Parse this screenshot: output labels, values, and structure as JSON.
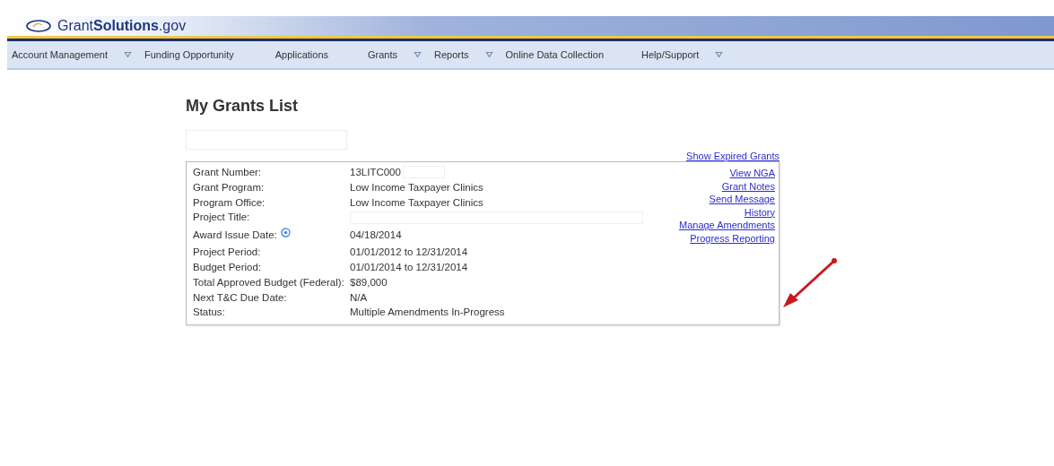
{
  "logo": {
    "text": "Grant**Solutions**.gov"
  },
  "nav": [
    {
      "label": "Account Management",
      "has_menu": true
    },
    {
      "label": "Funding Opportunity",
      "has_menu": false
    },
    {
      "label": "Applications",
      "has_menu": false
    },
    {
      "label": "Grants",
      "has_menu": true
    },
    {
      "label": "Reports",
      "has_menu": true
    },
    {
      "label": "Online Data Collection",
      "has_menu": false
    },
    {
      "label": "Help/Support",
      "has_menu": true
    }
  ],
  "page_title": "My Grants List",
  "show_expired_link": "Show Expired Grants",
  "grant": {
    "fields": [
      {
        "label": "Grant Number:",
        "value": "13LITC000",
        "redacted": true,
        "help": false
      },
      {
        "label": "Grant Program:",
        "value": "Low Income Taxpayer Clinics",
        "redacted": false,
        "help": false
      },
      {
        "label": "Program Office:",
        "value": "Low Income Taxpayer Clinics",
        "redacted": false,
        "help": false
      },
      {
        "label": "Project Title:",
        "redacted": true,
        "help": false
      },
      {
        "label": "Award Issue Date:",
        "value": "04/18/2014",
        "redacted": false,
        "help": true
      },
      {
        "label": "Project Period:",
        "value": "01/01/2012 to 12/31/2014",
        "redacted": false,
        "help": false
      },
      {
        "label": "Budget Period:",
        "value": "01/01/2014 to 12/31/2014",
        "redacted": false,
        "help": false
      },
      {
        "label": "Total Approved Budget (Federal):",
        "value": "$89,000",
        "redacted": false,
        "help": false
      },
      {
        "label": "Next T&C Due Date:",
        "value": "N/A",
        "redacted": false,
        "help": false
      },
      {
        "label": "Status:",
        "value": "Multiple Amendments In-Progress",
        "redacted": false,
        "help": false
      }
    ],
    "links": [
      "View NGA",
      "Grant Notes",
      "Send Message",
      "History",
      "Manage Amendments",
      "Progress Reporting"
    ]
  }
}
